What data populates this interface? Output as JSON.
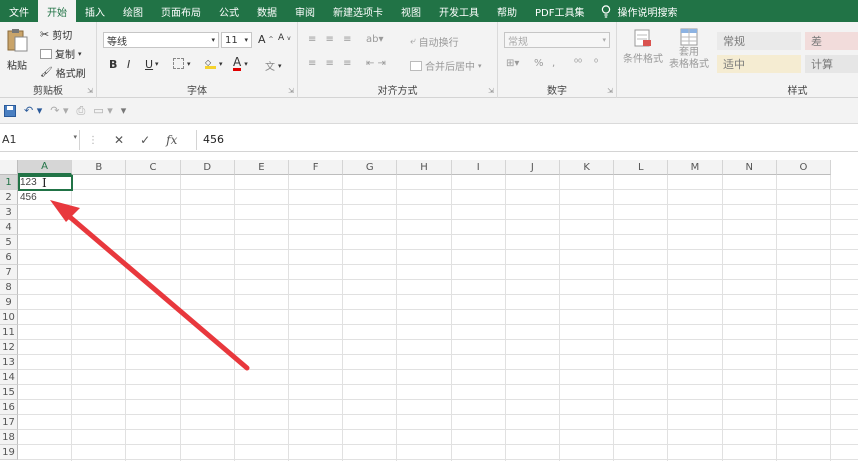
{
  "menu": {
    "tabs": [
      "文件",
      "开始",
      "插入",
      "绘图",
      "页面布局",
      "公式",
      "数据",
      "审阅",
      "新建选项卡",
      "视图",
      "开发工具",
      "帮助",
      "PDF工具集"
    ],
    "active_index": 1,
    "tell_me": "操作说明搜索"
  },
  "ribbon": {
    "clipboard": {
      "paste": "粘贴",
      "cut": "剪切",
      "copy": "复制",
      "format_painter": "格式刷",
      "label": "剪贴板"
    },
    "font": {
      "font_name": "等线",
      "font_size": "11",
      "label": "字体",
      "bold": "B",
      "italic": "I",
      "underline": "U",
      "grow": "A",
      "shrink": "A",
      "font_color": "A"
    },
    "alignment": {
      "wrap": "自动换行",
      "merge": "合并后居中",
      "label": "对齐方式"
    },
    "number": {
      "format": "常规",
      "percent": "%",
      "label": "数字"
    },
    "styles": {
      "conditional": "条件格式",
      "table_format_1": "套用",
      "table_format_2": "表格格式",
      "normal": "常规",
      "bad": "差",
      "neutral": "适中",
      "calculation": "计算",
      "label": "样式"
    }
  },
  "formula_bar": {
    "name_box": "A1",
    "cancel": "✕",
    "enter": "✓",
    "fx": "fx",
    "value": "456"
  },
  "grid": {
    "columns": [
      "A",
      "B",
      "C",
      "D",
      "E",
      "F",
      "G",
      "H",
      "I",
      "J",
      "K",
      "L",
      "M",
      "N",
      "O"
    ],
    "rows": [
      "1",
      "2",
      "3",
      "4",
      "5",
      "6",
      "7",
      "8",
      "9",
      "10",
      "11",
      "12",
      "13",
      "14",
      "15",
      "16",
      "17",
      "18",
      "19"
    ],
    "cells": {
      "A1": "123",
      "A2": "456"
    }
  },
  "colors": {
    "accent": "#217346",
    "arrow": "#e8383d"
  }
}
